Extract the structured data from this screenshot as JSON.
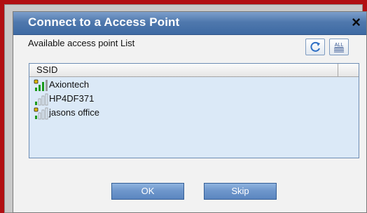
{
  "dialog": {
    "title": "Connect to a Access Point",
    "close_label": "×",
    "list_label": "Available access point List",
    "toolbar": {
      "all_label": "ALL"
    },
    "table": {
      "columns": [
        "SSID",
        ""
      ],
      "rows": [
        {
          "ssid": "Axiontech",
          "signal_bars": 3,
          "locked": true
        },
        {
          "ssid": "HP4DF371",
          "signal_bars": 1,
          "locked": false
        },
        {
          "ssid": "jasons office",
          "signal_bars": 1,
          "locked": true
        }
      ]
    },
    "buttons": {
      "ok_label": "OK",
      "skip_label": "Skip"
    }
  },
  "colors": {
    "accent": "#4f78ad",
    "list_background": "#dbe9f7",
    "signal_active": "#1c9a1c",
    "signal_inactive": "#9a9a9a",
    "lock": "#e0b800"
  },
  "icons": {
    "refresh": "refresh-icon",
    "select_all": "select-all-icon",
    "wifi_signal": "wifi-signal-icon",
    "lock": "lock-icon"
  }
}
